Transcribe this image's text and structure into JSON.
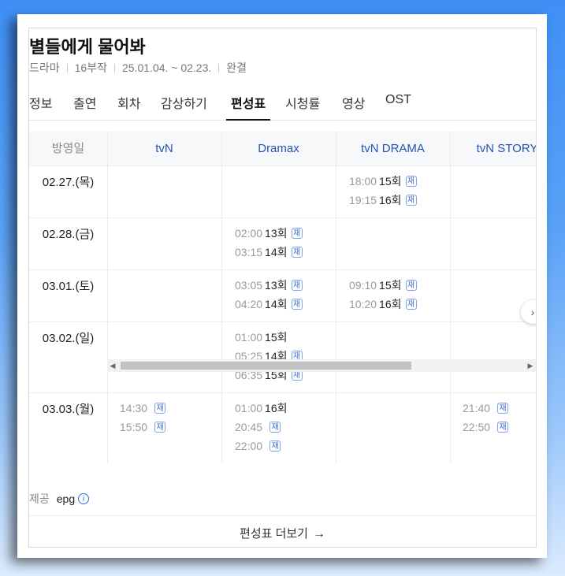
{
  "program": {
    "title": "별들에게 물어봐",
    "meta": [
      "드라마",
      "16부작",
      "25.01.04. ~ 02.23.",
      "완결"
    ]
  },
  "tabs": [
    {
      "label": "정보"
    },
    {
      "label": "출연"
    },
    {
      "label": "회차"
    },
    {
      "label": "감상하기"
    },
    {
      "label": "편성표",
      "active": true
    },
    {
      "label": "시청률"
    },
    {
      "label": "영상"
    },
    {
      "label": "OST"
    }
  ],
  "schedule": {
    "date_header": "방영일",
    "channels": [
      "tvN",
      "Dramax",
      "tvN DRAMA",
      "tvN STORY"
    ],
    "rerun_badge": "재",
    "rows": [
      {
        "date": "02.27.(목)",
        "cells": [
          [],
          [],
          [
            {
              "time": "18:00",
              "ep": "15회",
              "rerun": true
            },
            {
              "time": "19:15",
              "ep": "16회",
              "rerun": true
            }
          ],
          []
        ]
      },
      {
        "date": "02.28.(금)",
        "cells": [
          [],
          [
            {
              "time": "02:00",
              "ep": "13회",
              "rerun": true
            },
            {
              "time": "03:15",
              "ep": "14회",
              "rerun": true
            }
          ],
          [],
          []
        ]
      },
      {
        "date": "03.01.(토)",
        "cells": [
          [],
          [
            {
              "time": "03:05",
              "ep": "13회",
              "rerun": true
            },
            {
              "time": "04:20",
              "ep": "14회",
              "rerun": true
            }
          ],
          [
            {
              "time": "09:10",
              "ep": "15회",
              "rerun": true
            },
            {
              "time": "10:20",
              "ep": "16회",
              "rerun": true
            }
          ],
          []
        ]
      },
      {
        "date": "03.02.(일)",
        "cells": [
          [],
          [
            {
              "time": "01:00",
              "ep": "15회",
              "rerun": false
            },
            {
              "time": "05:25",
              "ep": "14회",
              "rerun": true
            },
            {
              "time": "06:35",
              "ep": "15회",
              "rerun": true
            }
          ],
          [],
          []
        ]
      },
      {
        "date": "03.03.(월)",
        "cells": [
          [
            {
              "time": "14:30",
              "ep": "",
              "rerun": true
            },
            {
              "time": "15:50",
              "ep": "",
              "rerun": true
            }
          ],
          [
            {
              "time": "01:00",
              "ep": "16회",
              "rerun": false
            },
            {
              "time": "20:45",
              "ep": "",
              "rerun": true
            },
            {
              "time": "22:00",
              "ep": "",
              "rerun": true
            }
          ],
          [],
          [
            {
              "time": "21:40",
              "ep": "",
              "rerun": true
            },
            {
              "time": "22:50",
              "ep": "",
              "rerun": true
            }
          ]
        ]
      }
    ]
  },
  "footer": {
    "provider_label": "제공",
    "provider_value": "epg",
    "info_glyph": "i",
    "more_label": "편성표 더보기"
  },
  "icons": {
    "next": "›",
    "scroll_left": "◀",
    "scroll_right": "▶",
    "more_arrow": "→"
  },
  "colors": {
    "channel_header": "#2353b8",
    "badge": "#3d6fd1"
  }
}
